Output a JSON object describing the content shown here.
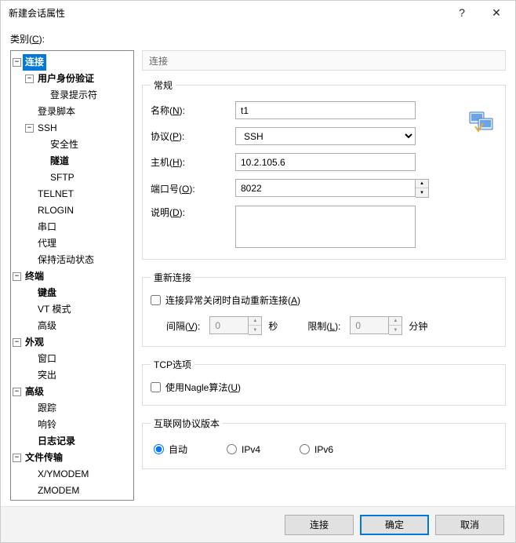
{
  "title": "新建会话属性",
  "category_label": "类别(C):",
  "tree": {
    "connection": "连接",
    "auth": "用户身份验证",
    "login_prompt": "登录提示符",
    "login_script": "登录脚本",
    "ssh": "SSH",
    "security": "安全性",
    "tunnel": "隧道",
    "sftp": "SFTP",
    "telnet": "TELNET",
    "rlogin": "RLOGIN",
    "serial": "串口",
    "proxy": "代理",
    "keepalive": "保持活动状态",
    "terminal": "终端",
    "keyboard": "键盘",
    "vtmode": "VT 模式",
    "advanced_term": "高级",
    "look": "外观",
    "window": "窗口",
    "highlight": "突出",
    "advanced": "高级",
    "trace": "跟踪",
    "bell": "响铃",
    "logging": "日志记录",
    "filetrans": "文件传输",
    "xymodem": "X/YMODEM",
    "zmodem": "ZMODEM"
  },
  "panel_title": "连接",
  "general": {
    "legend": "常规",
    "name_label": "名称(N):",
    "name_value": "t1",
    "protocol_label": "协议(P):",
    "protocol_value": "SSH",
    "host_label": "主机(H):",
    "host_value": "10.2.105.6",
    "port_label": "端口号(O):",
    "port_value": "8022",
    "desc_label": "说明(D):",
    "desc_value": ""
  },
  "reconnect": {
    "legend": "重新连接",
    "checkbox_label": "连接异常关闭时自动重新连接(A)",
    "interval_label": "间隔(V):",
    "interval_value": "0",
    "interval_unit": "秒",
    "limit_label": "限制(L):",
    "limit_value": "0",
    "limit_unit": "分钟"
  },
  "tcp": {
    "legend": "TCP选项",
    "nagle_label": "使用Nagle算法(U)"
  },
  "ipver": {
    "legend": "互联网协议版本",
    "auto": "自动",
    "v4": "IPv4",
    "v6": "IPv6"
  },
  "buttons": {
    "connect": "连接",
    "ok": "确定",
    "cancel": "取消"
  }
}
